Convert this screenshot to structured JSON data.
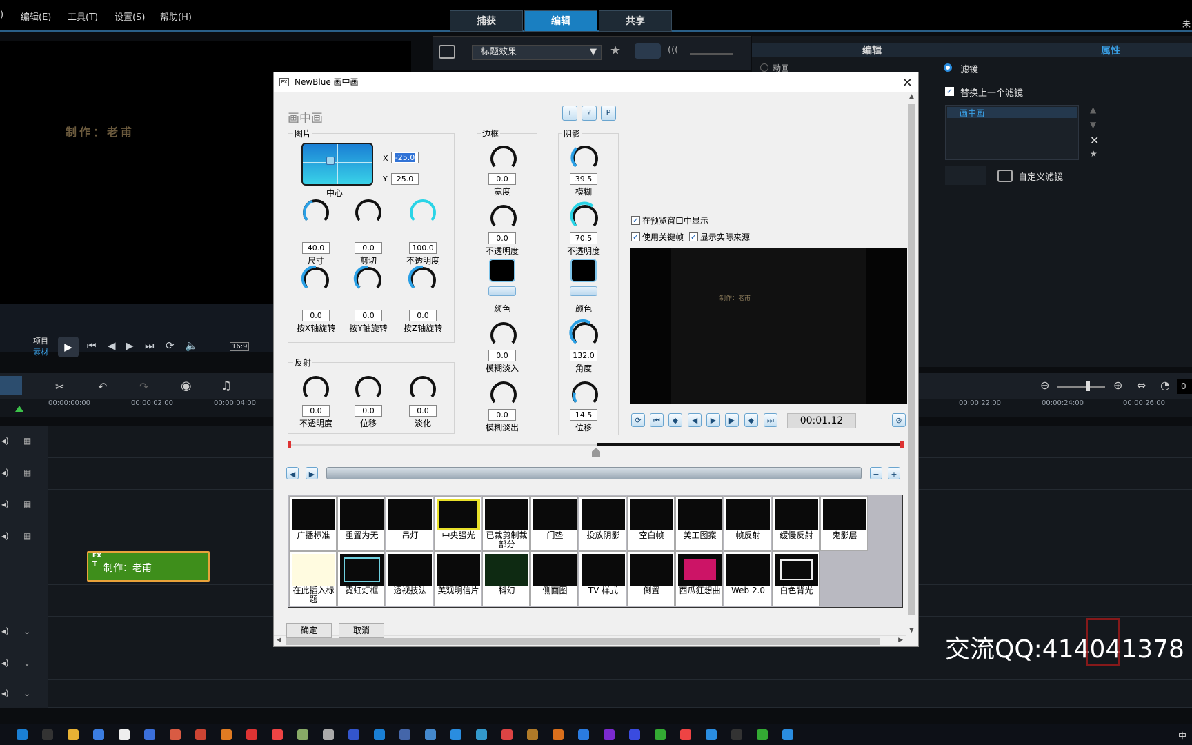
{
  "menu": {
    "items": [
      "编辑(E)",
      "工具(T)",
      "设置(S)",
      "帮助(H)"
    ]
  },
  "tabs": [
    "捕获",
    "编辑",
    "共享"
  ],
  "preview": {
    "overlay_text": "制作：老甫"
  },
  "player": {
    "project_label": "项目",
    "clip_label": "素材",
    "aspect": "16:9"
  },
  "mid_panel": {
    "dropdown": "标题效果"
  },
  "right_panel": {
    "tab_edit": "编辑",
    "tab_props": "属性",
    "radio_anim": "动画",
    "radio_filter": "滤镜",
    "replace_label": "替换上一个滤镜",
    "filter_item": "画中画",
    "custom_filter": "自定义滤镜",
    "corner_text": "未"
  },
  "timeline": {
    "ruler": [
      "00:00:00:00",
      "00:00:02:00",
      "00:00:04:00",
      "00:00:22:00",
      "00:00:24:00",
      "00:00:26:00"
    ],
    "clip_label": "制作：老甫",
    "clip_badge": "FX",
    "zoom_field": "0"
  },
  "dialog": {
    "title": "NewBlue 画中画",
    "heading": "画中画",
    "picture": {
      "label": "图片",
      "center_label": "中心",
      "x_label": "X",
      "x_value": "-25.0",
      "y_label": "Y",
      "y_value": "25.0",
      "knobs": [
        {
          "value": "40.0",
          "label": "尺寸"
        },
        {
          "value": "0.0",
          "label": "剪切"
        },
        {
          "value": "100.0",
          "label": "不透明度"
        },
        {
          "value": "0.0",
          "label": "按X轴旋转"
        },
        {
          "value": "0.0",
          "label": "按Y轴旋转"
        },
        {
          "value": "0.0",
          "label": "按Z轴旋转"
        }
      ]
    },
    "reflection": {
      "label": "反射",
      "knobs": [
        {
          "value": "0.0",
          "label": "不透明度"
        },
        {
          "value": "0.0",
          "label": "位移"
        },
        {
          "value": "0.0",
          "label": "淡化"
        }
      ]
    },
    "border": {
      "label": "边框",
      "knobs": [
        {
          "value": "0.0",
          "label": "宽度"
        },
        {
          "value": "0.0",
          "label": "不透明度"
        },
        {
          "value": "0.0",
          "label": "模糊淡入"
        },
        {
          "value": "0.0",
          "label": "模糊淡出"
        }
      ],
      "color_label": "颜色"
    },
    "shadow": {
      "label": "阴影",
      "knobs": [
        {
          "value": "39.5",
          "label": "模糊"
        },
        {
          "value": "70.5",
          "label": "不透明度"
        },
        {
          "value": "132.0",
          "label": "角度"
        },
        {
          "value": "14.5",
          "label": "位移"
        }
      ],
      "color_label": "颜色"
    },
    "top_buttons": [
      "i",
      "?",
      "P"
    ],
    "options": {
      "show_in_preview": "在预览窗口中显示",
      "use_keyframes": "使用关键帧",
      "show_source": "显示实际来源"
    },
    "preview_text": "制作：老甫",
    "timecode": "00:01.12",
    "presets": [
      "广播标准",
      "重置为无",
      "吊灯",
      "中央强光",
      "已裁剪制裁部分",
      "门垫",
      "投放阴影",
      "空白帧",
      "美工图案",
      "帧反射",
      "缓慢反射",
      "鬼影层",
      "在此插入标题",
      "霓虹灯框",
      "透视技法",
      "美观明信片",
      "科幻",
      "侧面图",
      "TV 样式",
      "倒置",
      "西瓜狂想曲",
      "Web 2.0",
      "白色背光"
    ],
    "ok": "确定",
    "cancel": "取消"
  },
  "watermark": "交流QQ:414041378",
  "taskbar": {
    "lang": "中"
  }
}
